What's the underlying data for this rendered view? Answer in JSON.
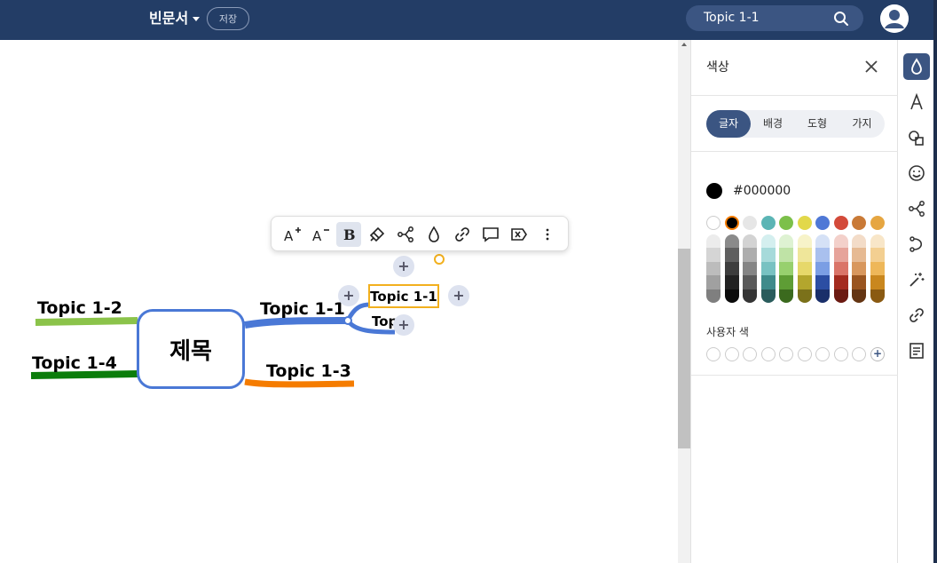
{
  "header": {
    "doc_title": "빈문서",
    "save_label": "저장",
    "search_value": "Topic 1-1"
  },
  "mindmap": {
    "central": "제목",
    "topics": {
      "t1_1": "Topic 1-1",
      "t1_2": "Topic 1-2",
      "t1_3": "Topic 1-3",
      "t1_4": "Topic 1-4"
    },
    "selected_subtopic": "Topic 1-1",
    "partial_subtopic": "Top",
    "branch_colors": {
      "t1_1": "#4a78d6",
      "t1_2": "#8bc34a",
      "t1_3": "#f57c00",
      "t1_4": "#0b7d0b"
    }
  },
  "toolbar": {
    "items": [
      "font-increase-icon",
      "font-decrease-icon",
      "bold-icon",
      "format-painter-icon",
      "branch-icon",
      "color-drop-icon",
      "link-icon",
      "comment-icon",
      "clear-format-icon",
      "more-icon"
    ]
  },
  "panel": {
    "title": "색상",
    "tabs": [
      "글자",
      "배경",
      "도형",
      "가지"
    ],
    "active_tab": "글자",
    "current_color": "#000000",
    "custom_label": "사용자 색",
    "base_swatches": [
      "#ffffff",
      "#000000",
      "#e6e6e6",
      "#5bb5b5",
      "#7cc04a",
      "#e2d84a",
      "#4f78d6",
      "#d34a3a",
      "#c97a37",
      "#e6a641"
    ],
    "palette_columns": [
      [
        "#ececec",
        "#d5d5d5",
        "#bcbcbc",
        "#a0a0a0",
        "#7f7f7f"
      ],
      [
        "#8a8a8a",
        "#5f5f5f",
        "#3d3d3d",
        "#222222",
        "#0b0b0b"
      ],
      [
        "#d3d3d3",
        "#adadad",
        "#858585",
        "#5a5a5a",
        "#353535"
      ],
      [
        "#d4efef",
        "#a6dada",
        "#78c2c2",
        "#3f8b8b",
        "#2a5c5c"
      ],
      [
        "#def2d2",
        "#bfe3a6",
        "#97d06e",
        "#5e9d35",
        "#3b6a1e"
      ],
      [
        "#f7f3c9",
        "#efe69a",
        "#e6d86a",
        "#b3a62d",
        "#7b711a"
      ],
      [
        "#d5e1f6",
        "#a9c0ee",
        "#7b9ee4",
        "#2c4ea3",
        "#1a2f6a"
      ],
      [
        "#f3d0ca",
        "#e6a39a",
        "#da7468",
        "#a42b1f",
        "#6b1a12"
      ],
      [
        "#f3dcc8",
        "#e6ba93",
        "#d8975d",
        "#9a5520",
        "#643513"
      ],
      [
        "#f8e6c8",
        "#f3cf91",
        "#eeb759",
        "#c9871e",
        "#8a5a12"
      ]
    ]
  },
  "rail": {
    "items": [
      "color-drop-icon",
      "text-style-icon",
      "shape-icon",
      "emoji-icon",
      "branch-icon",
      "relationship-icon",
      "magic-icon",
      "link-icon",
      "note-icon"
    ]
  }
}
